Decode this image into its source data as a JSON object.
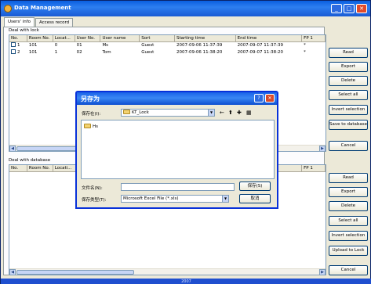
{
  "window": {
    "title": "Data Management"
  },
  "tabs": [
    "Users' info",
    "Access record"
  ],
  "top_group": {
    "label": "Deal with lock",
    "columns": [
      "No.",
      "Room No.",
      "Locat...",
      "User No.",
      "User name",
      "Sort",
      "Starting time",
      "End time",
      "FP 1"
    ],
    "rows": [
      [
        "1",
        "101",
        "0",
        "01",
        "Ms",
        "Guest",
        "2007-09-06 11:37:39",
        "2007-09-07 11:37:39",
        "*"
      ],
      [
        "2",
        "101",
        "1",
        "02",
        "Tom",
        "Guest",
        "2007-09-06 11:38:20",
        "2007-09-07 11:38:20",
        "*"
      ]
    ]
  },
  "bottom_group": {
    "label": "Deal with database",
    "columns": [
      "No.",
      "Room No.",
      "Locati...",
      "FP 1"
    ]
  },
  "top_buttons": [
    "Read",
    "Export",
    "Delete",
    "Select all",
    "Invert selection",
    "Save to database",
    "Cancel"
  ],
  "bottom_buttons": [
    "Read",
    "Export",
    "Delete",
    "Select all",
    "Invert selection",
    "Upload to Lock",
    "Cancel"
  ],
  "dialog": {
    "title": "另存为",
    "save_in_label": "保存在(I):",
    "save_in_value": "KT_Lock",
    "folder_item": "Hs",
    "filename_label": "文件名(N):",
    "filename_value": "",
    "filetype_label": "保存类型(T):",
    "filetype_value": "Microsoft Excel File (*.xls)",
    "save_button": "保存(S)",
    "cancel_button": "取消"
  },
  "taskbar_text": "2007"
}
